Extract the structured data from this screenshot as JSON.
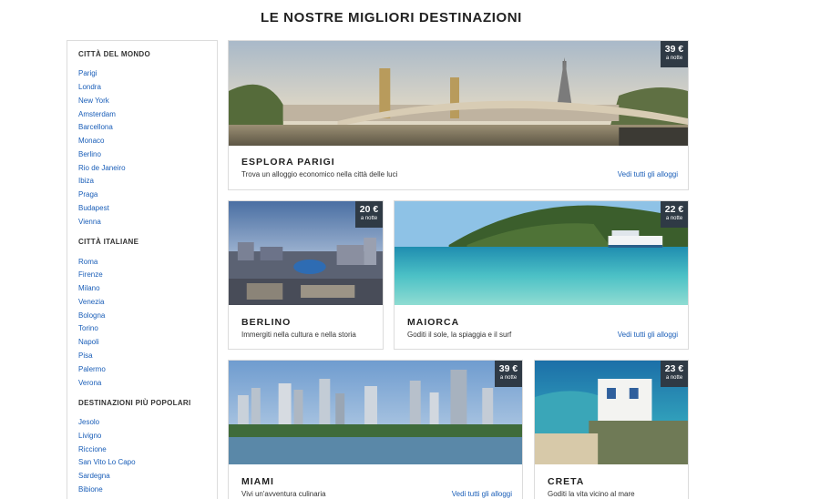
{
  "page": {
    "title": "LE NOSTRE MIGLIORI DESTINAZIONI"
  },
  "sidebar": {
    "sections": [
      {
        "title": "CITTÀ DEL MONDO",
        "items": [
          "Parigi",
          "Londra",
          "New York",
          "Amsterdam",
          "Barcellona",
          "Monaco",
          "Berlino",
          "Rio de Janeiro",
          "Ibiza",
          "Praga",
          "Budapest",
          "Vienna"
        ]
      },
      {
        "title": "CITTÀ ITALIANE",
        "items": [
          "Roma",
          "Firenze",
          "Milano",
          "Venezia",
          "Bologna",
          "Torino",
          "Napoli",
          "Pisa",
          "Palermo",
          "Verona"
        ]
      },
      {
        "title": "DESTINAZIONI PIÙ POPOLARI",
        "items": [
          "Jesolo",
          "Livigno",
          "Riccione",
          "San Vito Lo Capo",
          "Sardegna",
          "Bibione"
        ]
      }
    ]
  },
  "cards": {
    "parigi": {
      "title": "ESPLORA PARIGI",
      "desc": "Trova un alloggio economico nella città delle luci",
      "link": "Vedi tutti gli alloggi",
      "price": "39 €",
      "unit": "a notte"
    },
    "berlino": {
      "title": "BERLINO",
      "desc": "Immergiti nella cultura e nella storia",
      "price": "20 €",
      "unit": "a notte"
    },
    "maiorca": {
      "title": "MAIORCA",
      "desc": "Goditi il sole, la spiaggia e il surf",
      "link": "Vedi tutti gli alloggi",
      "price": "22 €",
      "unit": "a notte"
    },
    "miami": {
      "title": "MIAMI",
      "desc": "Vivi un'avventura culinaria",
      "link": "Vedi tutti gli alloggi",
      "price": "39 €",
      "unit": "a notte"
    },
    "creta": {
      "title": "CRETA",
      "desc": "Goditi la vita vicino al mare",
      "price": "23 €",
      "unit": "a notte"
    }
  }
}
